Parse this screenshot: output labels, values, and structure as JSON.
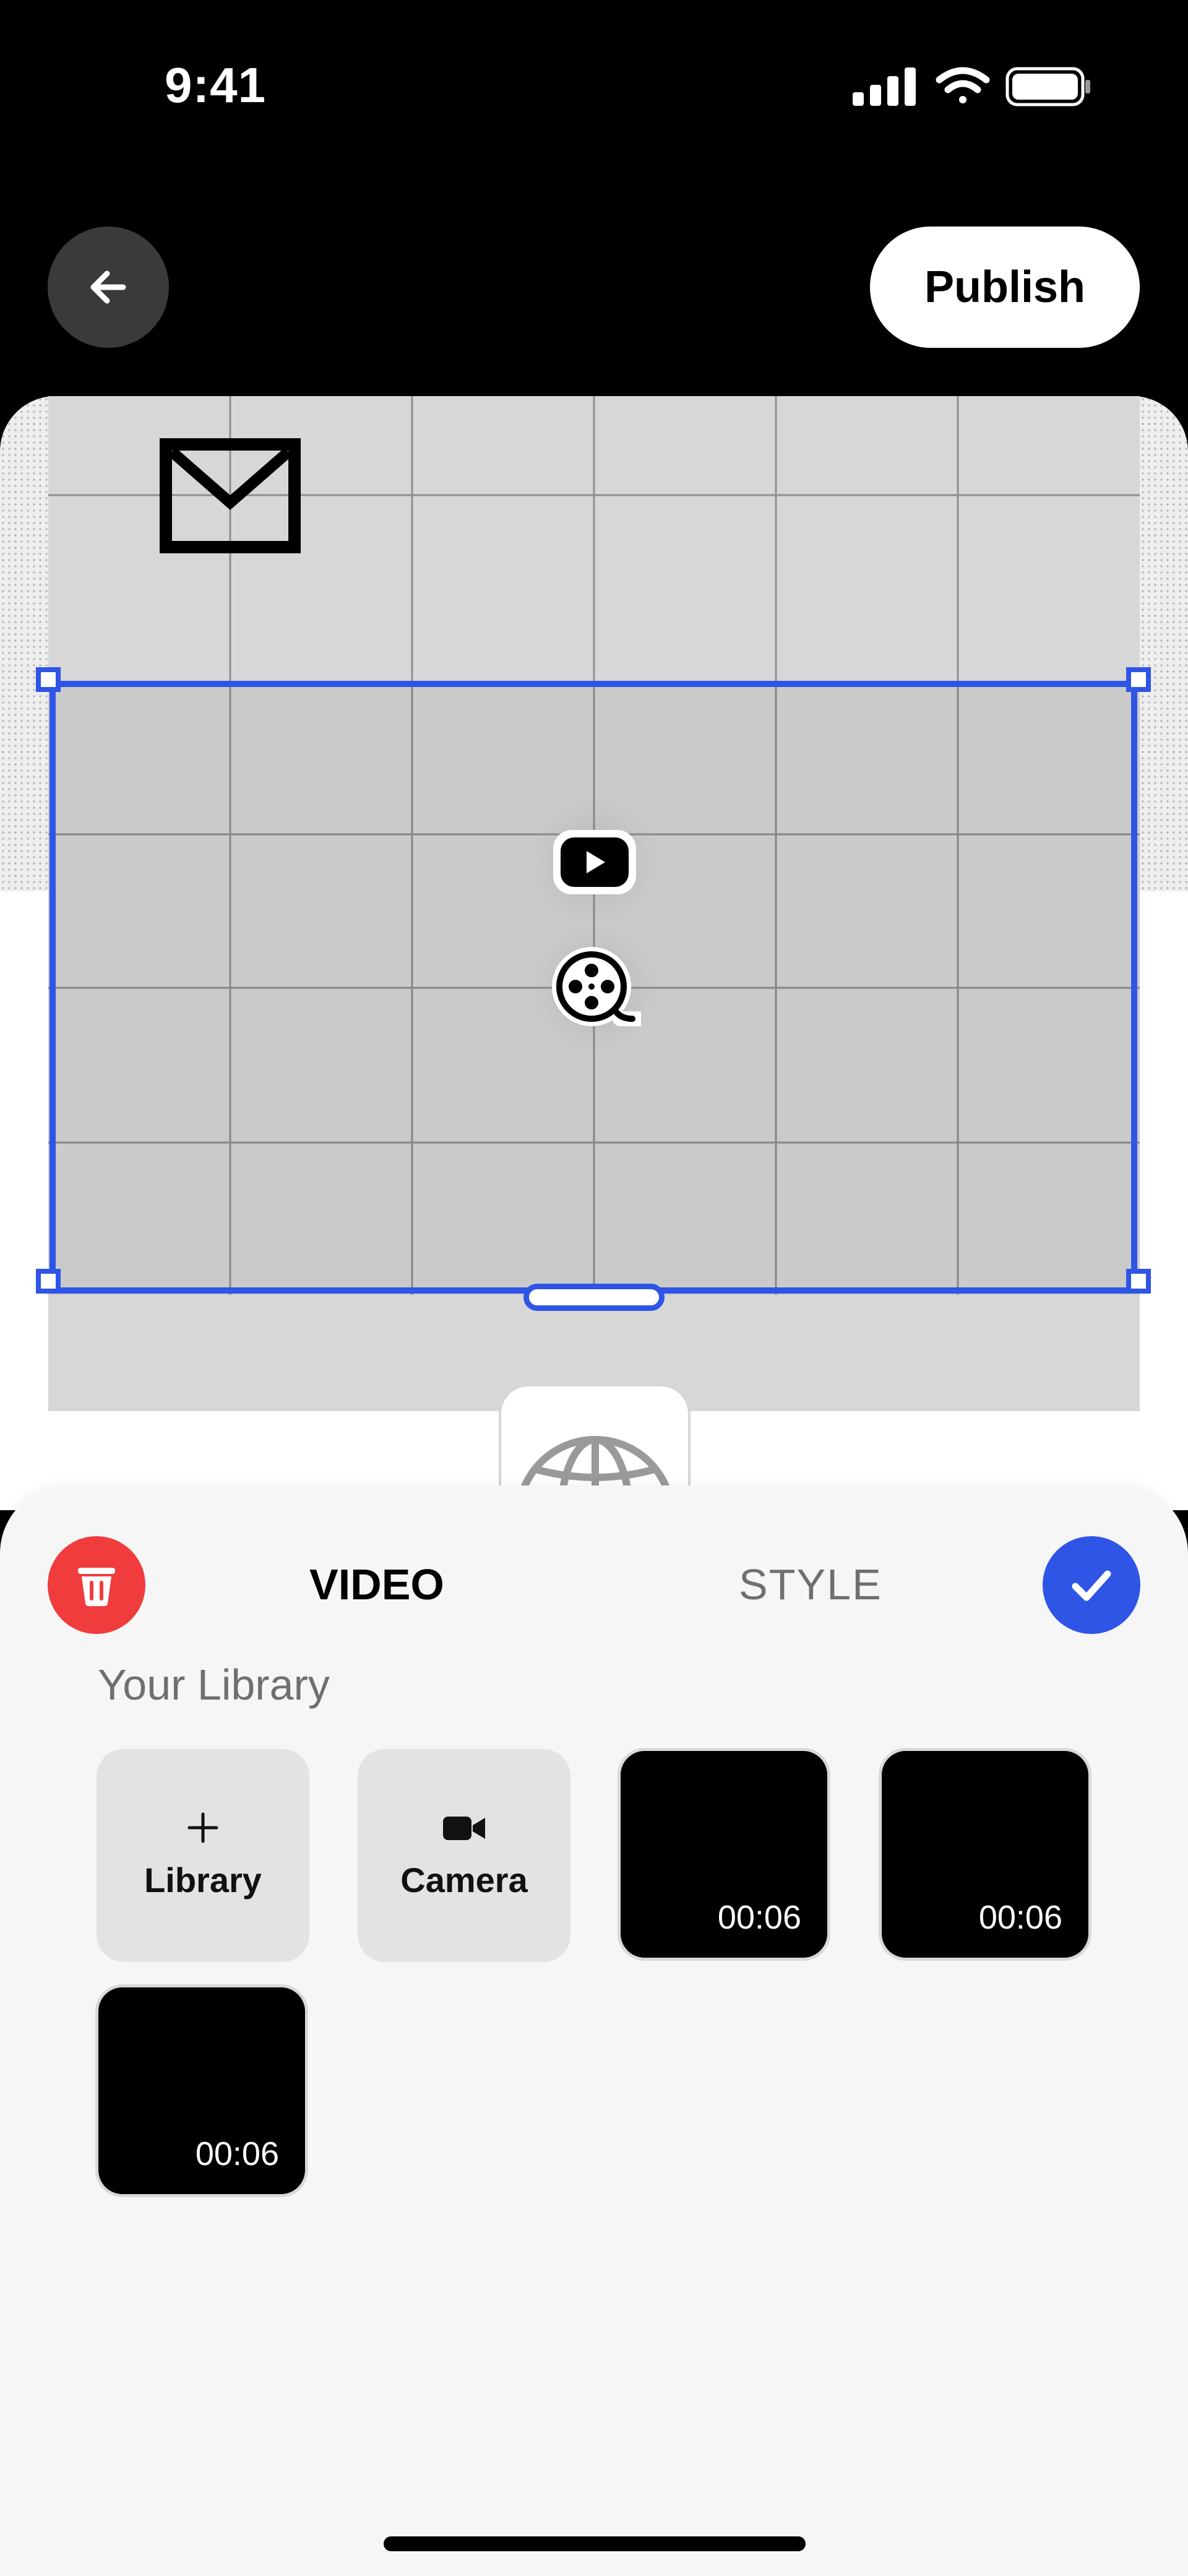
{
  "status_bar": {
    "time": "9:41",
    "icons": [
      "signal-icon",
      "wifi-icon",
      "battery-icon"
    ]
  },
  "top_nav": {
    "back_icon": "arrow-left-icon",
    "publish_label": "Publish"
  },
  "canvas": {
    "icons": [
      "mail-icon",
      "youtube-play-icon",
      "film-reel-icon",
      "globe-icon"
    ]
  },
  "bottom_sheet": {
    "delete_icon": "trash-icon",
    "tabs": [
      {
        "label": "VIDEO",
        "active": true
      },
      {
        "label": "STYLE",
        "active": false
      }
    ],
    "confirm_icon": "checkmark-icon",
    "section_title": "Your Library",
    "actions": [
      {
        "label": "Library",
        "icon": "plus-icon"
      },
      {
        "label": "Camera",
        "icon": "video-camera-icon"
      }
    ],
    "videos": [
      {
        "duration": "00:06"
      },
      {
        "duration": "00:06"
      },
      {
        "duration": "00:06"
      }
    ]
  },
  "colors": {
    "accent": "#2f55e6",
    "delete": "#f03c3c",
    "sheet_bg": "#f6f6f6",
    "grid_bg": "#d7d7d7"
  }
}
